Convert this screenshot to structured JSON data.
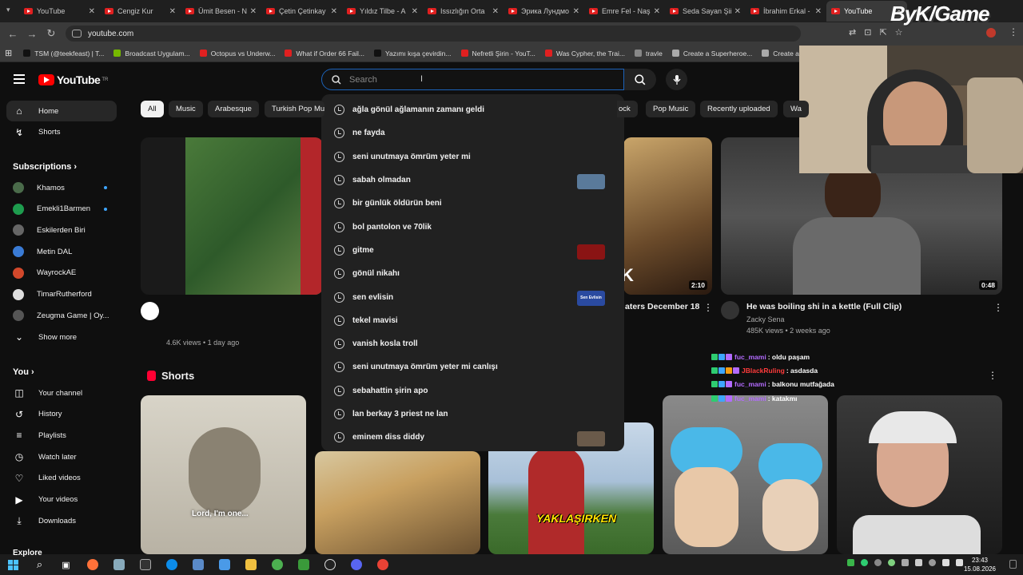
{
  "browser": {
    "tabs": [
      {
        "label": "YouTube",
        "active": false
      },
      {
        "label": "Cengiz Kur",
        "active": false
      },
      {
        "label": "Ümit Besen - N",
        "active": false
      },
      {
        "label": "Çetin Çetinkay",
        "active": false
      },
      {
        "label": "Yıldız Tilbe - A",
        "active": false
      },
      {
        "label": "Issızlığın Orta",
        "active": false
      },
      {
        "label": "Эрика Лундмо",
        "active": false
      },
      {
        "label": "Emre Fel - Naş",
        "active": false
      },
      {
        "label": "Seda Sayan Şiir",
        "active": false
      },
      {
        "label": "İbrahim Erkal -",
        "active": false
      },
      {
        "label": "YouTube",
        "active": true
      }
    ],
    "url": "youtube.com",
    "bookmarks": [
      {
        "label": "TSM (@teekfeast) | T...",
        "icon": "tiktok-icon"
      },
      {
        "label": "Broadcast Uygulam...",
        "icon": "nvidia-icon"
      },
      {
        "label": "Octopus vs Underw...",
        "icon": "youtube-icon"
      },
      {
        "label": "What if Order 66 Fail...",
        "icon": "youtube-icon"
      },
      {
        "label": "Yazımı kışa çevirdin...",
        "icon": "tiktok-icon"
      },
      {
        "label": "Nefretli Şirin - YouT...",
        "icon": "youtube-icon"
      },
      {
        "label": "Was Cypher, the Trai...",
        "icon": "youtube-icon"
      },
      {
        "label": "travle",
        "icon": "globe-icon"
      },
      {
        "label": "Create a Superheroe...",
        "icon": "page-icon"
      },
      {
        "label": "Create a Star Wars C...",
        "icon": "page-icon"
      }
    ]
  },
  "youtube": {
    "logo_text": "YouTube",
    "logo_region": "TR",
    "search": {
      "placeholder": "Search",
      "value": ""
    },
    "sidebar": {
      "main": [
        {
          "label": "Home",
          "icon": "home-icon",
          "active": true
        },
        {
          "label": "Shorts",
          "icon": "shorts-icon",
          "active": false
        }
      ],
      "subscriptions_title": "Subscriptions",
      "subscriptions": [
        {
          "label": "Khamos",
          "color": "#4a6b4a",
          "new": true
        },
        {
          "label": "Emekli1Barmen",
          "color": "#1e9c4e",
          "new": true
        },
        {
          "label": "Eskilerden Biri",
          "color": "#666666",
          "new": false
        },
        {
          "label": "Metin DAL",
          "color": "#3a7bd5",
          "new": false
        },
        {
          "label": "WayrockAE",
          "color": "#d2482b",
          "new": false
        },
        {
          "label": "TimarRutherford",
          "color": "#dddddd",
          "new": false
        },
        {
          "label": "Zeugma Game | Oy...",
          "color": "#555555",
          "new": false
        }
      ],
      "show_more": "Show more",
      "you_title": "You",
      "you_items": [
        {
          "label": "Your channel",
          "icon": "channel-icon"
        },
        {
          "label": "History",
          "icon": "history-icon"
        },
        {
          "label": "Playlists",
          "icon": "playlists-icon"
        },
        {
          "label": "Watch later",
          "icon": "watch-later-icon"
        },
        {
          "label": "Liked videos",
          "icon": "like-icon"
        },
        {
          "label": "Your videos",
          "icon": "your-videos-icon"
        },
        {
          "label": "Downloads",
          "icon": "download-icon"
        }
      ],
      "explore_title": "Explore"
    },
    "chips": [
      "All",
      "Music",
      "Arabesque",
      "Turkish Pop Mu",
      "ock",
      "Pop Music",
      "Recently uploaded",
      "Wa"
    ],
    "suggestions": [
      {
        "text": "ağla gönül ağlamanın zamanı geldi",
        "thumb": ""
      },
      {
        "text": "ne fayda",
        "thumb": ""
      },
      {
        "text": "seni unutmaya ömrüm yeter mi",
        "thumb": ""
      },
      {
        "text": "sabah olmadan",
        "thumb": "#5a7a9a"
      },
      {
        "text": "bir günlük öldürün beni",
        "thumb": ""
      },
      {
        "text": "bol pantolon ve 70lik",
        "thumb": ""
      },
      {
        "text": "gitme",
        "thumb": "#8a1414"
      },
      {
        "text": "gönül nikahı",
        "thumb": ""
      },
      {
        "text": "sen evlisin",
        "thumb": "#2a4aa0"
      },
      {
        "text": "tekel mavisi",
        "thumb": ""
      },
      {
        "text": "vanish kosla troll",
        "thumb": ""
      },
      {
        "text": "seni unutmaya ömrüm yeter mi canlışı",
        "thumb": ""
      },
      {
        "text": "sebahattin şirin apo",
        "thumb": ""
      },
      {
        "text": "lan berkay 3 priest ne lan",
        "thumb": ""
      },
      {
        "text": "eminem diss diddy",
        "thumb": "#6a5a4a"
      }
    ],
    "suggestion_thumb_text": {
      "sen_evlisin": "Sen Evlisin"
    },
    "videos": [
      {
        "meta": "4.6K views • 1 day ago"
      },
      {
        "title_fragment": "aters December 18",
        "duration": "2:10",
        "thumb_text": "K"
      },
      {
        "title": "He was boiling shi in a kettle (Full Clip)",
        "channel": "Zacky Sena",
        "meta": "485K views • 2 weeks ago",
        "duration": "0:48"
      }
    ],
    "shorts_title": "Shorts",
    "shorts": [
      {
        "caption": "Lord, I'm one..."
      },
      {
        "caption": ""
      },
      {
        "caption": "YAKLAŞIRKEN"
      },
      {
        "caption": ""
      },
      {
        "caption": ""
      }
    ]
  },
  "stream_overlay": {
    "watermark": "ByK/Game",
    "chat": [
      {
        "user": "fuc_mami",
        "msg": ": oldu paşam",
        "user_color": "#b36bff"
      },
      {
        "user": "JBlackRuling",
        "msg": ": asdasda",
        "user_color": "#ff3b3b"
      },
      {
        "user": "fuc_mami",
        "msg": ": balkonu mutfağada",
        "user_color": "#b36bff"
      },
      {
        "user": "fuc_mami",
        "msg": ": katakmı",
        "user_color": "#b36bff"
      }
    ]
  },
  "taskbar": {
    "time": "23:43",
    "date": "15.08.2026"
  }
}
